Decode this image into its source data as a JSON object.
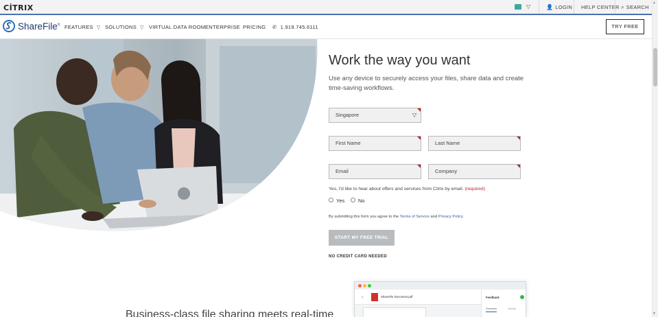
{
  "topbar": {
    "brand": "CİTRIX",
    "flag_icon": "singapore-flag-icon",
    "login_label": "LOGIN",
    "help_center_label": "HELP CENTER",
    "search_label": "SEARCH"
  },
  "nav": {
    "brand": "ShareFile",
    "brand_mark": "®",
    "features": "FEATURES",
    "solutions": "SOLUTIONS",
    "vdr": "VIRTUAL DATA ROOM",
    "enterprise": "ENTERPRISE",
    "pricing": "PRICING",
    "phone": "1.919.745.6111",
    "try_free": "TRY FREE"
  },
  "hero": {
    "title": "Work the way you want",
    "subtitle": "Use any device to securely access your files, share data and create time-saving workflows."
  },
  "form": {
    "country_value": "Singapore",
    "first_name_placeholder": "First Name",
    "last_name_placeholder": "Last Name",
    "email_placeholder": "Email",
    "company_placeholder": "Company",
    "consent_text": "Yes, I'd like to hear about offers and services from Citrix by email.",
    "consent_required": "(required)",
    "yes_label": "Yes",
    "no_label": "No",
    "terms_prefix": "By submitting this form you agree to the",
    "terms_link": "Terms of Service",
    "terms_and": "and",
    "privacy_link": "Privacy Policy",
    "terms_suffix": ".",
    "submit_label": "START MY FREE TRIAL",
    "no_card": "NO CREDIT CARD NEEDED"
  },
  "bottom": {
    "heading": "Business-class file sharing meets real-time",
    "mock_file": "ShareFile Document.pdf",
    "mock_feedback": "Feedback",
    "mock_tab_overview": "Overview",
    "mock_tab_activity": "Activity"
  },
  "colors": {
    "accent_blue": "#4a6fb5",
    "brand_navy": "#1f3a6e",
    "required_red": "#c0262c",
    "button_gray": "#b9bcbf"
  }
}
